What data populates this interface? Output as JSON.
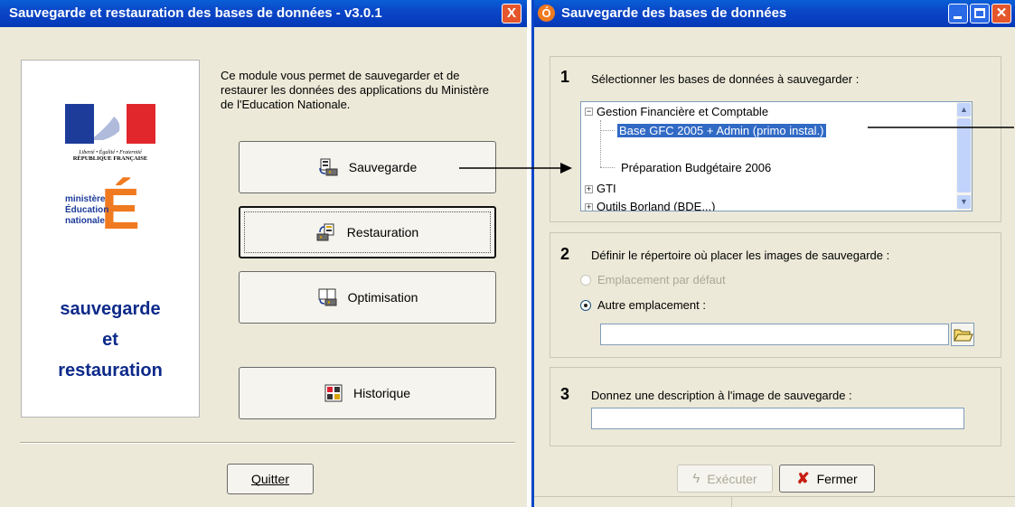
{
  "left_window": {
    "title": "Sauvegarde et restauration des bases de données - v3.0.1",
    "close_label": "X",
    "description": "Ce module vous permet de sauvegarder et de restaurer les données des applications du Ministère de l'Education Nationale.",
    "logo_rf_text": "Liberté • Égalité • Fraternité",
    "logo_rf_title": "RÉPUBLIQUE FRANÇAISE",
    "logo_min_lines": [
      "ministère",
      "Éducation",
      "nationale"
    ],
    "logo_min_letter": "É",
    "brand_line1": "sauvegarde",
    "brand_line2": "et",
    "brand_line3": "restauration",
    "buttons": {
      "sauvegarde": "Sauvegarde",
      "restauration": "Restauration",
      "optimisation": "Optimisation",
      "historique": "Historique",
      "quitter": "Quitter"
    }
  },
  "right_window": {
    "title": "Sauvegarde des bases de données",
    "step1": {
      "number": "1",
      "label": "Sélectionner les bases de données à sauvegarder :",
      "tree": [
        "Gestion Financière et Comptable",
        "Base GFC 2005 + Admin (primo instal.)",
        "Préparation Budgétaire 2006",
        "GTI",
        "Outils Borland (BDE...)"
      ]
    },
    "step2": {
      "number": "2",
      "label": "Définir le répertoire où placer les images de sauvegarde :",
      "option_default": "Emplacement par défaut",
      "option_other": "Autre emplacement :",
      "path_value": ""
    },
    "step3": {
      "number": "3",
      "label": "Donnez une description à l'image de sauvegarde :",
      "description_value": ""
    },
    "buttons": {
      "executer": "Exécuter",
      "fermer": "Fermer"
    }
  },
  "colors": {
    "titlebar": "#0a46c8",
    "window_bg": "#ece9d8",
    "brand_text": "#0d2a8a",
    "selection": "#316ac5",
    "close_button": "#e4562b"
  }
}
